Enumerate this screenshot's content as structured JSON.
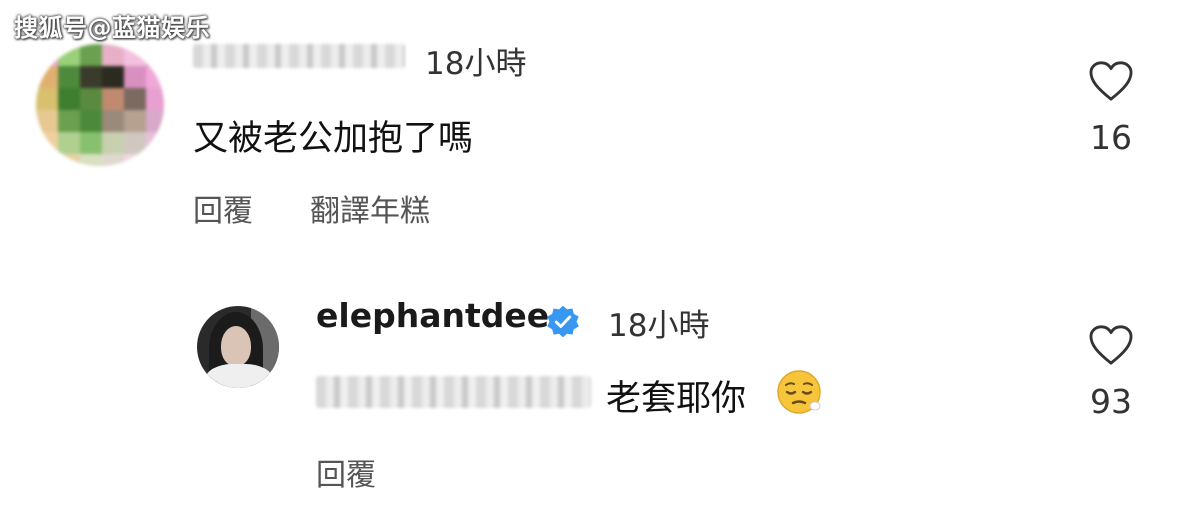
{
  "watermark": "搜狐号@蓝猫娱乐",
  "comment": {
    "time": "18小時",
    "text": "又被老公加抱了嗎",
    "likes": "16",
    "reply_label": "回覆",
    "translate_label": "翻譯年糕"
  },
  "reply": {
    "username": "elephantdee",
    "verified": true,
    "time": "18小時",
    "text": "老套耶你",
    "emoji": "pensive-face",
    "likes": "93",
    "reply_label": "回覆"
  },
  "icons": {
    "heart": "heart-outline-icon",
    "verified": "verified-badge-icon"
  },
  "colors": {
    "verified_blue": "#3897f0",
    "text_primary": "#111111",
    "text_secondary": "#555555"
  }
}
